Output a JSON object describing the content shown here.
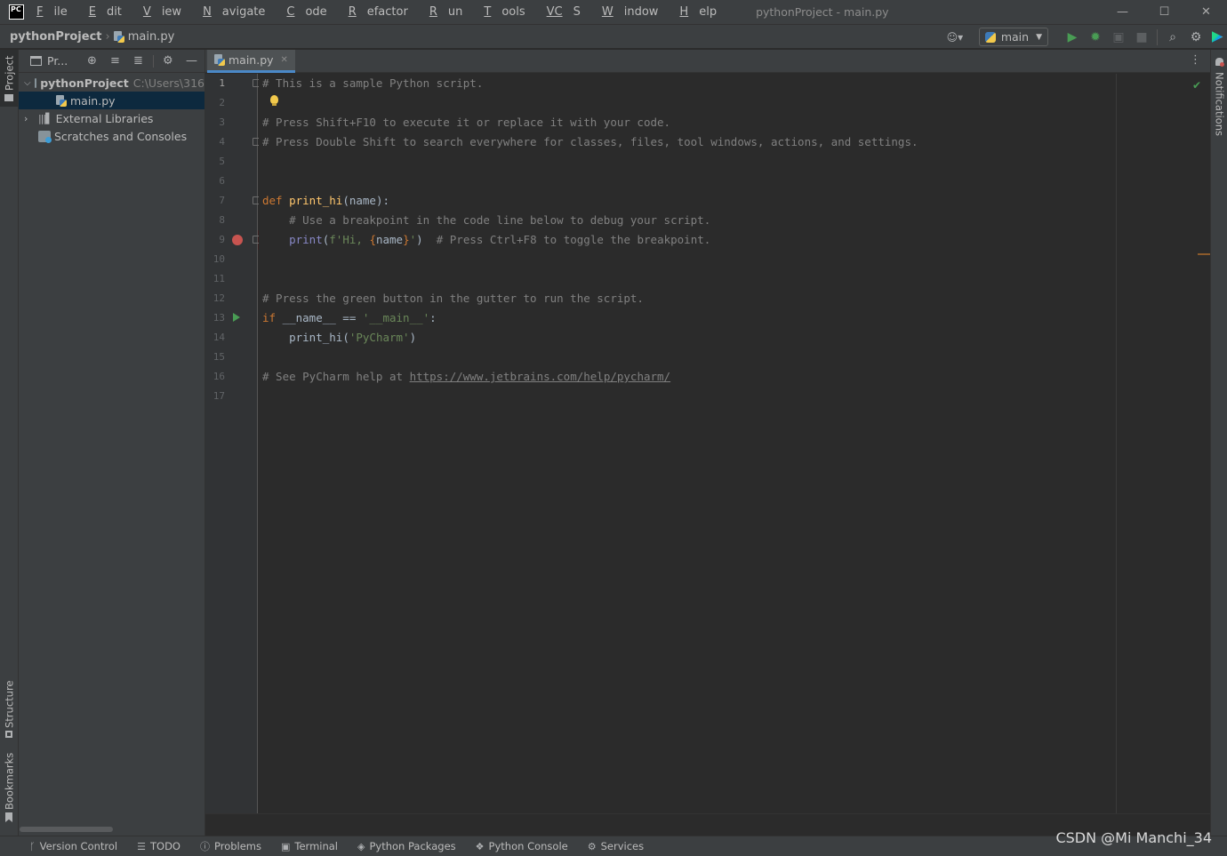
{
  "window": {
    "logo_text": "PC",
    "title": "pythonProject - main.py",
    "menu": [
      {
        "key": "F",
        "rest": "ile"
      },
      {
        "key": "E",
        "rest": "dit"
      },
      {
        "key": "V",
        "rest": "iew"
      },
      {
        "key": "N",
        "rest": "avigate"
      },
      {
        "key": "C",
        "rest": "ode"
      },
      {
        "key": "R",
        "rest": "efactor"
      },
      {
        "key": "R",
        "rest": "un"
      },
      {
        "key": "T",
        "rest": "ools"
      },
      {
        "key": "VC",
        "rest": "S"
      },
      {
        "key": "W",
        "rest": "indow"
      },
      {
        "key": "H",
        "rest": "elp"
      }
    ]
  },
  "breadcrumb": {
    "project": "pythonProject",
    "file": "main.py"
  },
  "run_config": {
    "label": "main"
  },
  "left_stripe": {
    "project": "Project",
    "structure": "Structure",
    "bookmarks": "Bookmarks"
  },
  "right_stripe": {
    "notifications": "Notifications"
  },
  "project_panel": {
    "title": "Pr...",
    "tree": [
      {
        "label": "pythonProject",
        "path": "C:\\Users\\316"
      },
      {
        "label": "main.py"
      },
      {
        "label": "External Libraries"
      },
      {
        "label": "Scratches and Consoles"
      }
    ]
  },
  "editor": {
    "tab_label": "main.py",
    "line_numbers": [
      "1",
      "2",
      "3",
      "4",
      "5",
      "6",
      "7",
      "8",
      "9",
      "10",
      "11",
      "12",
      "13",
      "14",
      "15",
      "16",
      "17"
    ],
    "lines": {
      "l1": "# This is a sample Python script.",
      "l3": "# Press Shift+F10 to execute it or replace it with your code.",
      "l4": "# Press Double Shift to search everywhere for classes, files, tool windows, actions, and settings.",
      "l7_kw": "def ",
      "l7_fn": "print_hi",
      "l7_rest": "(name):",
      "l8": "    # Use a breakpoint in the code line below to debug your script.",
      "l9_bi": "print",
      "l9_p1": "(",
      "l9_s1": "f'Hi, ",
      "l9_b1": "{",
      "l9_var": "name",
      "l9_b2": "}",
      "l9_s2": "'",
      "l9_p2": ")",
      "l9_cmt": "  # Press Ctrl+F8 to toggle the breakpoint.",
      "l12": "# Press the green button in the gutter to run the script.",
      "l13_kw": "if ",
      "l13_rest": "__name__ == ",
      "l13_str": "'__main__'",
      "l13_colon": ":",
      "l14_call": "print_hi(",
      "l14_str": "'PyCharm'",
      "l14_close": ")",
      "l16_cmt": "# See PyCharm help at ",
      "l16_link": "https://www.jetbrains.com/help/pycharm/"
    }
  },
  "statusbar": {
    "items": [
      "Version Control",
      "TODO",
      "Problems",
      "Terminal",
      "Python Packages",
      "Python Console",
      "Services"
    ]
  },
  "watermark": "CSDN @Mi Manchi_34",
  "colors": {
    "accent": "#4a88c7",
    "breakpoint": "#c75450",
    "run": "#499c54"
  }
}
